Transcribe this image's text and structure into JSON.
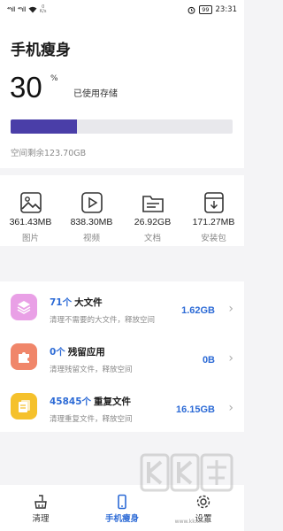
{
  "status_bar": {
    "signal_1": "⁴⁶ıll",
    "signal_2": "⁴⁶ıll",
    "speed_value": "0",
    "speed_unit": "K/s",
    "battery": "99",
    "time": "23:31"
  },
  "page": {
    "title": "手机瘦身",
    "used_percent": "30",
    "percent_sign": "%",
    "used_label": "已使用存储",
    "used_fraction": 0.3,
    "remaining": "空间剩余123.70GB"
  },
  "categories": [
    {
      "size": "361.43MB",
      "label": "图片",
      "icon": "image-icon"
    },
    {
      "size": "838.30MB",
      "label": "视频",
      "icon": "video-icon"
    },
    {
      "size": "26.92GB",
      "label": "文档",
      "icon": "folder-icon"
    },
    {
      "size": "171.27MB",
      "label": "安装包",
      "icon": "package-icon"
    }
  ],
  "items": [
    {
      "count": "71个",
      "name": "大文件",
      "desc": "清理不需要的大文件，释放空间",
      "size": "1.62GB",
      "icon": "layers-icon",
      "color": "#e9a0e6"
    },
    {
      "count": "0个",
      "name": "残留应用",
      "desc": "清理残留文件，释放空间",
      "size": "0B",
      "icon": "puzzle-icon",
      "color": "#f0866a"
    },
    {
      "count": "45845个",
      "name": "重复文件",
      "desc": "清理重复文件，释放空间",
      "size": "16.15GB",
      "icon": "files-icon",
      "color": "#f5c12c"
    }
  ],
  "tabs": [
    {
      "label": "清理",
      "icon": "broom-icon"
    },
    {
      "label": "手机瘦身",
      "icon": "phone-icon"
    },
    {
      "label": "设置",
      "icon": "gear-icon"
    }
  ],
  "watermark": "www.kkx.net",
  "colors": {
    "accent": "#2d6bd6",
    "progress": "#4a3ea8"
  }
}
